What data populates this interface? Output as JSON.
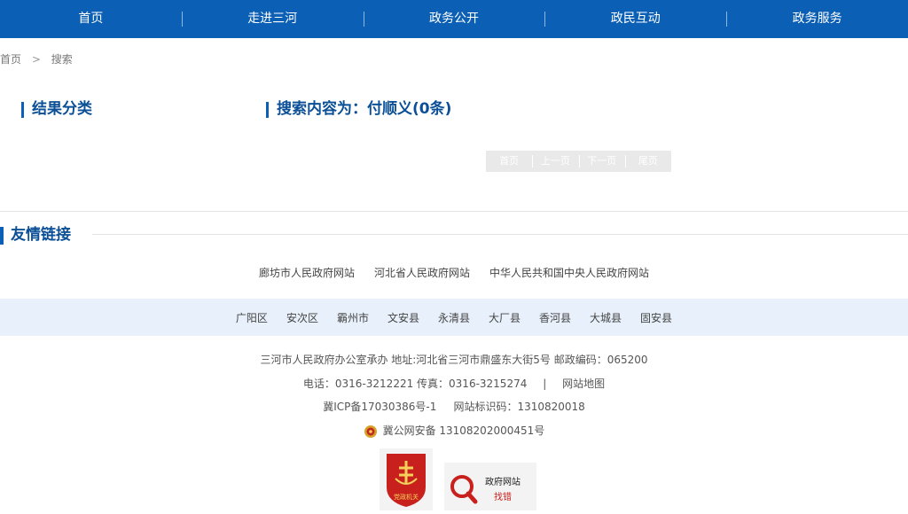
{
  "nav": {
    "items": [
      "首页",
      "走进三河",
      "政务公开",
      "政民互动",
      "政务服务"
    ]
  },
  "breadcrumb": {
    "home": "首页",
    "separator": ">",
    "current": "搜索"
  },
  "results": {
    "category_title": "结果分类",
    "search_title": "搜索内容为：付顺义(0条)"
  },
  "pager": {
    "first": "首页",
    "prev": "上一页",
    "next": "下一页",
    "last": "尾页"
  },
  "links": {
    "title": "友情链接",
    "friends": [
      "廊坊市人民政府网站",
      "河北省人民政府网站",
      "中华人民共和国中央人民政府网站"
    ],
    "counties": [
      "广阳区",
      "安次区",
      "霸州市",
      "文安县",
      "永清县",
      "大厂县",
      "香河县",
      "大城县",
      "固安县"
    ]
  },
  "footer": {
    "host": "三河市人民政府办公室承办 地址:河北省三河市鼎盛东大街5号 邮政编码：065200",
    "phone": "电话：0316-3212221 传真：0316-3215274",
    "pipe": "|",
    "sitemap": "网站地图",
    "icp": "冀ICP备17030386号-1     网站标识码：1310820018",
    "police": "冀公网安备 13108202000451号"
  },
  "badges": {
    "red_badge_text": "党政机关",
    "gov_badge_line1": "政府网站",
    "gov_badge_line2": "找错"
  },
  "colors": {
    "nav_bg": "#0b5fb5",
    "title_blue": "#0b4f96",
    "county_bar_bg": "#e8f1fb"
  }
}
